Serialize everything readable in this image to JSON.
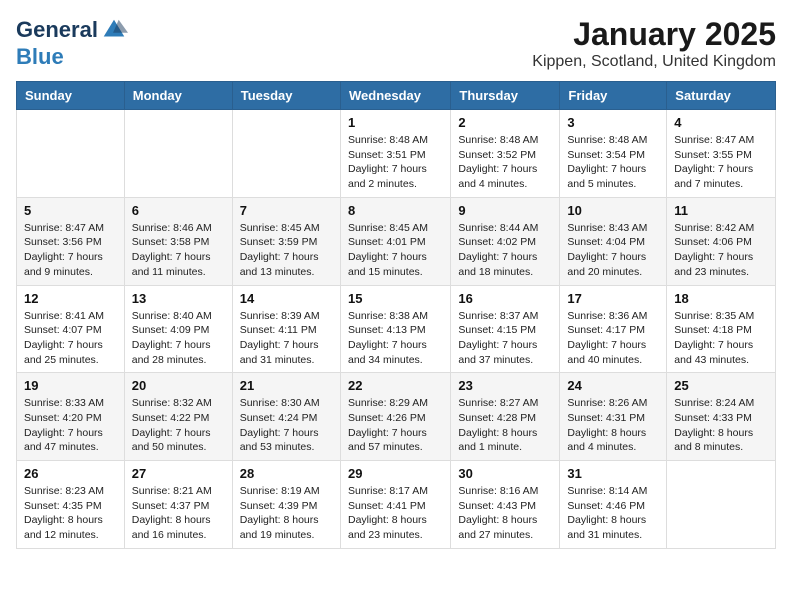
{
  "logo": {
    "general": "General",
    "blue": "Blue"
  },
  "title": "January 2025",
  "location": "Kippen, Scotland, United Kingdom",
  "days_of_week": [
    "Sunday",
    "Monday",
    "Tuesday",
    "Wednesday",
    "Thursday",
    "Friday",
    "Saturday"
  ],
  "weeks": [
    [
      {
        "day": "",
        "info": ""
      },
      {
        "day": "",
        "info": ""
      },
      {
        "day": "",
        "info": ""
      },
      {
        "day": "1",
        "info": "Sunrise: 8:48 AM\nSunset: 3:51 PM\nDaylight: 7 hours\nand 2 minutes."
      },
      {
        "day": "2",
        "info": "Sunrise: 8:48 AM\nSunset: 3:52 PM\nDaylight: 7 hours\nand 4 minutes."
      },
      {
        "day": "3",
        "info": "Sunrise: 8:48 AM\nSunset: 3:54 PM\nDaylight: 7 hours\nand 5 minutes."
      },
      {
        "day": "4",
        "info": "Sunrise: 8:47 AM\nSunset: 3:55 PM\nDaylight: 7 hours\nand 7 minutes."
      }
    ],
    [
      {
        "day": "5",
        "info": "Sunrise: 8:47 AM\nSunset: 3:56 PM\nDaylight: 7 hours\nand 9 minutes."
      },
      {
        "day": "6",
        "info": "Sunrise: 8:46 AM\nSunset: 3:58 PM\nDaylight: 7 hours\nand 11 minutes."
      },
      {
        "day": "7",
        "info": "Sunrise: 8:45 AM\nSunset: 3:59 PM\nDaylight: 7 hours\nand 13 minutes."
      },
      {
        "day": "8",
        "info": "Sunrise: 8:45 AM\nSunset: 4:01 PM\nDaylight: 7 hours\nand 15 minutes."
      },
      {
        "day": "9",
        "info": "Sunrise: 8:44 AM\nSunset: 4:02 PM\nDaylight: 7 hours\nand 18 minutes."
      },
      {
        "day": "10",
        "info": "Sunrise: 8:43 AM\nSunset: 4:04 PM\nDaylight: 7 hours\nand 20 minutes."
      },
      {
        "day": "11",
        "info": "Sunrise: 8:42 AM\nSunset: 4:06 PM\nDaylight: 7 hours\nand 23 minutes."
      }
    ],
    [
      {
        "day": "12",
        "info": "Sunrise: 8:41 AM\nSunset: 4:07 PM\nDaylight: 7 hours\nand 25 minutes."
      },
      {
        "day": "13",
        "info": "Sunrise: 8:40 AM\nSunset: 4:09 PM\nDaylight: 7 hours\nand 28 minutes."
      },
      {
        "day": "14",
        "info": "Sunrise: 8:39 AM\nSunset: 4:11 PM\nDaylight: 7 hours\nand 31 minutes."
      },
      {
        "day": "15",
        "info": "Sunrise: 8:38 AM\nSunset: 4:13 PM\nDaylight: 7 hours\nand 34 minutes."
      },
      {
        "day": "16",
        "info": "Sunrise: 8:37 AM\nSunset: 4:15 PM\nDaylight: 7 hours\nand 37 minutes."
      },
      {
        "day": "17",
        "info": "Sunrise: 8:36 AM\nSunset: 4:17 PM\nDaylight: 7 hours\nand 40 minutes."
      },
      {
        "day": "18",
        "info": "Sunrise: 8:35 AM\nSunset: 4:18 PM\nDaylight: 7 hours\nand 43 minutes."
      }
    ],
    [
      {
        "day": "19",
        "info": "Sunrise: 8:33 AM\nSunset: 4:20 PM\nDaylight: 7 hours\nand 47 minutes."
      },
      {
        "day": "20",
        "info": "Sunrise: 8:32 AM\nSunset: 4:22 PM\nDaylight: 7 hours\nand 50 minutes."
      },
      {
        "day": "21",
        "info": "Sunrise: 8:30 AM\nSunset: 4:24 PM\nDaylight: 7 hours\nand 53 minutes."
      },
      {
        "day": "22",
        "info": "Sunrise: 8:29 AM\nSunset: 4:26 PM\nDaylight: 7 hours\nand 57 minutes."
      },
      {
        "day": "23",
        "info": "Sunrise: 8:27 AM\nSunset: 4:28 PM\nDaylight: 8 hours\nand 1 minute."
      },
      {
        "day": "24",
        "info": "Sunrise: 8:26 AM\nSunset: 4:31 PM\nDaylight: 8 hours\nand 4 minutes."
      },
      {
        "day": "25",
        "info": "Sunrise: 8:24 AM\nSunset: 4:33 PM\nDaylight: 8 hours\nand 8 minutes."
      }
    ],
    [
      {
        "day": "26",
        "info": "Sunrise: 8:23 AM\nSunset: 4:35 PM\nDaylight: 8 hours\nand 12 minutes."
      },
      {
        "day": "27",
        "info": "Sunrise: 8:21 AM\nSunset: 4:37 PM\nDaylight: 8 hours\nand 16 minutes."
      },
      {
        "day": "28",
        "info": "Sunrise: 8:19 AM\nSunset: 4:39 PM\nDaylight: 8 hours\nand 19 minutes."
      },
      {
        "day": "29",
        "info": "Sunrise: 8:17 AM\nSunset: 4:41 PM\nDaylight: 8 hours\nand 23 minutes."
      },
      {
        "day": "30",
        "info": "Sunrise: 8:16 AM\nSunset: 4:43 PM\nDaylight: 8 hours\nand 27 minutes."
      },
      {
        "day": "31",
        "info": "Sunrise: 8:14 AM\nSunset: 4:46 PM\nDaylight: 8 hours\nand 31 minutes."
      },
      {
        "day": "",
        "info": ""
      }
    ]
  ]
}
